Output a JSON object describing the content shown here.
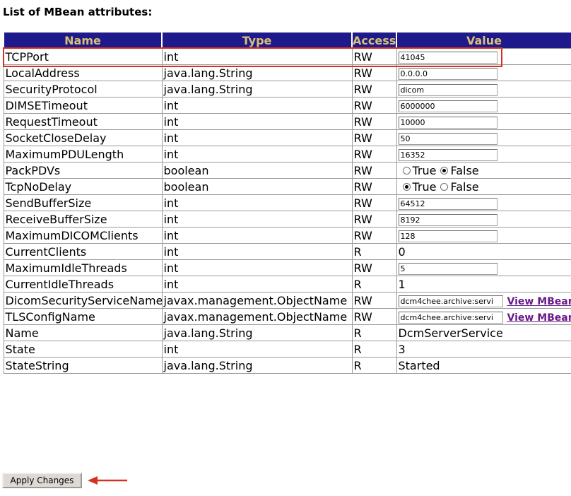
{
  "title": "List of MBean attributes:",
  "columns": {
    "name": "Name",
    "type": "Type",
    "access": "Access",
    "value": "Value"
  },
  "rows": [
    {
      "name": "TCPPort",
      "type": "int",
      "access": "RW",
      "kind": "input",
      "value": "41045"
    },
    {
      "name": "LocalAddress",
      "type": "java.lang.String",
      "access": "RW",
      "kind": "input",
      "value": "0.0.0.0"
    },
    {
      "name": "SecurityProtocol",
      "type": "java.lang.String",
      "access": "RW",
      "kind": "input",
      "value": "dicom"
    },
    {
      "name": "DIMSETimeout",
      "type": "int",
      "access": "RW",
      "kind": "input",
      "value": "6000000"
    },
    {
      "name": "RequestTimeout",
      "type": "int",
      "access": "RW",
      "kind": "input",
      "value": "10000"
    },
    {
      "name": "SocketCloseDelay",
      "type": "int",
      "access": "RW",
      "kind": "input",
      "value": "50"
    },
    {
      "name": "MaximumPDULength",
      "type": "int",
      "access": "RW",
      "kind": "input",
      "value": "16352"
    },
    {
      "name": "PackPDVs",
      "type": "boolean",
      "access": "RW",
      "kind": "radio",
      "true_label": "True",
      "false_label": "False",
      "selected": "False"
    },
    {
      "name": "TcpNoDelay",
      "type": "boolean",
      "access": "RW",
      "kind": "radio",
      "true_label": "True",
      "false_label": "False",
      "selected": "True"
    },
    {
      "name": "SendBufferSize",
      "type": "int",
      "access": "RW",
      "kind": "input",
      "value": "64512"
    },
    {
      "name": "ReceiveBufferSize",
      "type": "int",
      "access": "RW",
      "kind": "input",
      "value": "8192"
    },
    {
      "name": "MaximumDICOMClients",
      "type": "int",
      "access": "RW",
      "kind": "input",
      "value": "128"
    },
    {
      "name": "CurrentClients",
      "type": "int",
      "access": "R",
      "kind": "text",
      "value": "0"
    },
    {
      "name": "MaximumIdleThreads",
      "type": "int",
      "access": "RW",
      "kind": "input",
      "value": "5"
    },
    {
      "name": "CurrentIdleThreads",
      "type": "int",
      "access": "R",
      "kind": "text",
      "value": "1"
    },
    {
      "name": "DicomSecurityServiceName",
      "type": "javax.management.ObjectName",
      "access": "RW",
      "kind": "input-link",
      "value": "dcm4chee.archive:servi",
      "link": "View MBean"
    },
    {
      "name": "TLSConfigName",
      "type": "javax.management.ObjectName",
      "access": "RW",
      "kind": "input-link",
      "value": "dcm4chee.archive:servi",
      "link": "View MBean"
    },
    {
      "name": "Name",
      "type": "java.lang.String",
      "access": "R",
      "kind": "text",
      "value": "DcmServerService"
    },
    {
      "name": "State",
      "type": "int",
      "access": "R",
      "kind": "text",
      "value": "3"
    },
    {
      "name": "StateString",
      "type": "java.lang.String",
      "access": "R",
      "kind": "text",
      "value": "Started"
    }
  ],
  "apply_button": "Apply Changes",
  "colors": {
    "header_bg": "#1f1a8c",
    "header_text": "#d7c077",
    "highlight": "#d2321e",
    "link": "#6a1a8a"
  }
}
